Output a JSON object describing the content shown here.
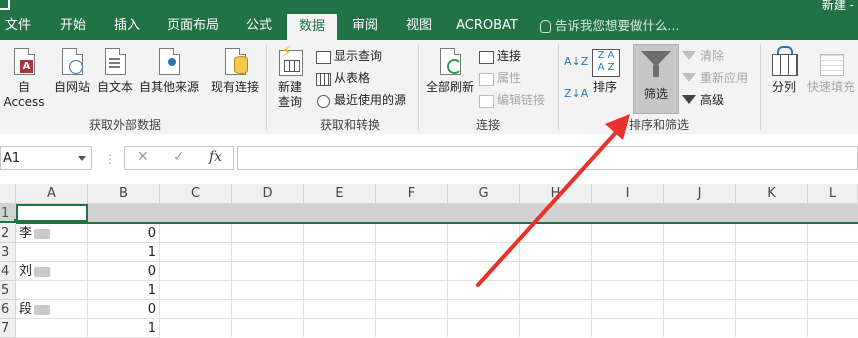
{
  "window": {
    "title_fragment": "新建 -"
  },
  "tabs": [
    {
      "label": "文件"
    },
    {
      "label": "开始"
    },
    {
      "label": "插入"
    },
    {
      "label": "页面布局"
    },
    {
      "label": "公式"
    },
    {
      "label": "数据"
    },
    {
      "label": "审阅"
    },
    {
      "label": "视图"
    },
    {
      "label": "ACROBAT"
    }
  ],
  "tell_me": "告诉我您想要做什么...",
  "ribbon": {
    "get_external": {
      "access": "自 Access",
      "web": "自网站",
      "text": "自文本",
      "other": "自其他来源",
      "existing": "现有连接",
      "group": "获取外部数据"
    },
    "transform": {
      "new_query_1": "新建",
      "new_query_2": "查询",
      "show_queries": "显示查询",
      "from_table": "从表格",
      "recent_sources": "最近使用的源",
      "group": "获取和转换"
    },
    "connections": {
      "refresh_all": "全部刷新",
      "connections": "连接",
      "properties": "属性",
      "edit_links": "编辑链接",
      "group": "连接"
    },
    "sort_filter": {
      "sort": "排序",
      "filter": "筛选",
      "clear": "清除",
      "reapply": "重新应用",
      "advanced": "高级",
      "group": "排序和筛选"
    },
    "data_tools": {
      "text_to_columns": "分列",
      "flash_fill": "快速填充"
    }
  },
  "formula_bar": {
    "name_box": "A1",
    "cancel": "✕",
    "enter": "✓",
    "fx": "fx",
    "formula": ""
  },
  "grid": {
    "columns": [
      "A",
      "B",
      "C",
      "D",
      "E",
      "F",
      "G",
      "H",
      "I",
      "J",
      "K",
      "L"
    ],
    "rows": [
      {
        "num": "1",
        "a": "",
        "b": ""
      },
      {
        "num": "2",
        "a": "李",
        "b": "0"
      },
      {
        "num": "3",
        "a": "",
        "b": "1"
      },
      {
        "num": "4",
        "a": "刘",
        "b": "0"
      },
      {
        "num": "5",
        "a": "",
        "b": "1"
      },
      {
        "num": "6",
        "a": "段",
        "b": "0"
      },
      {
        "num": "7",
        "a": "",
        "b": "1"
      }
    ]
  },
  "colors": {
    "excel_green": "#217346",
    "annotation_arrow": "#e8322b",
    "selected_header": "#d2d2d2"
  }
}
